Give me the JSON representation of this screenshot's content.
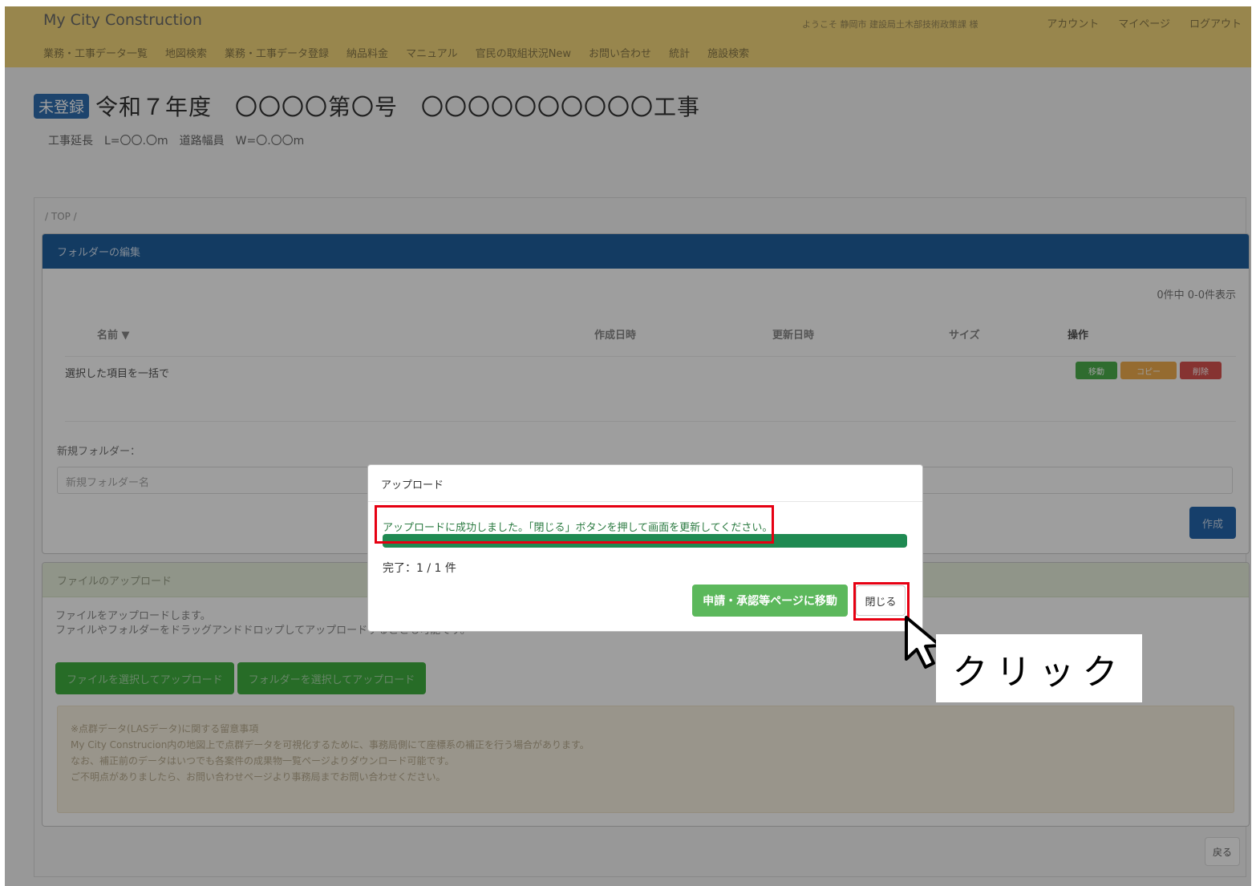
{
  "header": {
    "brand": "My City Construction",
    "welcome": "ようこそ 静岡市 建設局土木部技術政策課 様",
    "top_links": [
      "アカウント",
      "マイページ",
      "ログアウト"
    ],
    "menu": [
      "業務・工事データ一覧",
      "地図検索",
      "業務・工事データ登録",
      "納品料金",
      "マニュアル",
      "官民の取組状況New",
      "お問い合わせ",
      "統計",
      "施設検索"
    ]
  },
  "project": {
    "status_badge": "未登録",
    "title": "令和７年度　〇〇〇〇第〇号　〇〇〇〇〇〇〇〇〇〇工事",
    "subinfo": "工事延長　L=〇〇.〇m　道路幅員　W=〇.〇〇m"
  },
  "breadcrumb": "/ TOP /",
  "folder_panel": {
    "heading": "フォルダーの編集",
    "count": "0件中 0-0件表示",
    "columns": [
      "名前 ▼",
      "作成日時",
      "更新日時",
      "サイズ",
      "操作"
    ],
    "batch_label": "選択した項目を一括で",
    "batch_buttons": [
      "移動",
      "コピー",
      "削除"
    ],
    "new_folder_label": "新規フォルダー：",
    "new_folder_placeholder": "新規フォルダー名",
    "create_button": "作成"
  },
  "upload_panel": {
    "heading": "ファイルのアップロード",
    "line1": "ファイルをアップロードします。",
    "line2": "ファイルやフォルダーをドラッグアンドドロップしてアップロードすることも可能です。",
    "btn_files": "ファイルを選択してアップロード",
    "btn_folder": "フォルダーを選択してアップロード",
    "notice_title": "※点群データ(LASデータ)に関する留意事項",
    "notice_1": "My City Construcion内の地図上で点群データを可視化するために、事務局側にて座標系の補正を行う場合があります。",
    "notice_2": "なお、補正前のデータはいつでも各案件の成果物一覧ページよりダウンロード可能です。",
    "notice_3": "ご不明点がありましたら、お問い合わせページより事務局までお問い合わせください。"
  },
  "back_button": "戻る",
  "modal": {
    "title": "アップロード",
    "message": "アップロードに成功しました。「閉じる」ボタンを押して画面を更新してください。",
    "progress_fraction": 1.0,
    "status": "完了：1 / 1 件",
    "goto_button": "申請・承認等ページに移動",
    "close_button": "閉じる"
  },
  "annotation": {
    "callout": "クリック",
    "highlight_color": "#e60012"
  },
  "colors": {
    "navbar": "#f6d97c",
    "panel_primary": "#1f5f9e",
    "success": "#5cb85c",
    "progress": "#1f8a52"
  }
}
